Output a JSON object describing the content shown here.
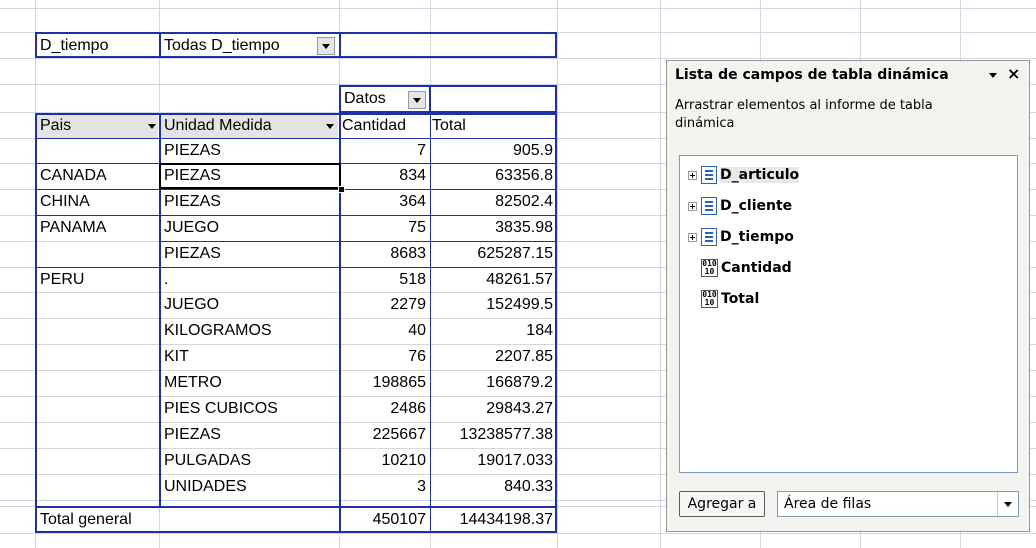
{
  "filter": {
    "label": "D_tiempo",
    "value": "Todas D_tiempo"
  },
  "pivot": {
    "data_header": "Datos",
    "row_headers": [
      "Pais",
      "Unidad Medida"
    ],
    "value_headers": [
      "Cantidad",
      "Total"
    ],
    "rows": [
      {
        "pais": "",
        "unidad": "PIEZAS",
        "cantidad": "7",
        "total": "905.9"
      },
      {
        "pais": "CANADA",
        "unidad": "PIEZAS",
        "cantidad": "834",
        "total": "63356.8"
      },
      {
        "pais": "CHINA",
        "unidad": "PIEZAS",
        "cantidad": "364",
        "total": "82502.4"
      },
      {
        "pais": "PANAMA",
        "unidad": "JUEGO",
        "cantidad": "75",
        "total": "3835.98"
      },
      {
        "pais": "",
        "unidad": "PIEZAS",
        "cantidad": "8683",
        "total": "625287.15"
      },
      {
        "pais": "PERU",
        "unidad": ".",
        "cantidad": "518",
        "total": "48261.57"
      },
      {
        "pais": "",
        "unidad": "JUEGO",
        "cantidad": "2279",
        "total": "152499.5"
      },
      {
        "pais": "",
        "unidad": "KILOGRAMOS",
        "cantidad": "40",
        "total": "184"
      },
      {
        "pais": "",
        "unidad": "KIT",
        "cantidad": "76",
        "total": "2207.85"
      },
      {
        "pais": "",
        "unidad": "METRO",
        "cantidad": "198865",
        "total": "166879.2"
      },
      {
        "pais": "",
        "unidad": "PIES CUBICOS",
        "cantidad": "2486",
        "total": "29843.27"
      },
      {
        "pais": "",
        "unidad": "PIEZAS",
        "cantidad": "225667",
        "total": "13238577.38"
      },
      {
        "pais": "",
        "unidad": "PULGADAS",
        "cantidad": "10210",
        "total": "19017.033"
      },
      {
        "pais": "",
        "unidad": "UNIDADES",
        "cantidad": "3",
        "total": "840.33"
      }
    ],
    "grand_total": {
      "label": "Total general",
      "cantidad": "450107",
      "total": "14434198.37"
    }
  },
  "panel": {
    "title": "Lista de campos de tabla dinámica",
    "description": "Arrastrar elementos al informe de tabla dinámica",
    "fields": [
      {
        "name": "D_articulo",
        "icon": "dimension-icon",
        "expandable": true
      },
      {
        "name": "D_cliente",
        "icon": "dimension-icon",
        "expandable": true
      },
      {
        "name": "D_tiempo",
        "icon": "dimension-icon",
        "expandable": true
      },
      {
        "name": "Cantidad",
        "icon": "measure-icon",
        "expandable": false
      },
      {
        "name": "Total",
        "icon": "measure-icon",
        "expandable": false
      }
    ],
    "add_button": "Agregar a",
    "area_select": "Área de filas",
    "measure_icon_glyph": "010\n10"
  }
}
